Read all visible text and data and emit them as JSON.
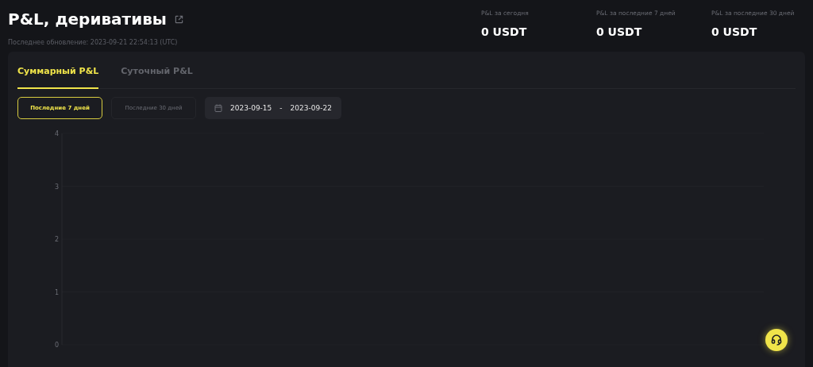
{
  "header": {
    "title": "P&L, деривативы",
    "updated": "Последнее обновление: 2023-09-21 22:54:13 (UTC)"
  },
  "stats": [
    {
      "label": "P&L за сегодня",
      "value": "0 USDT"
    },
    {
      "label": "P&L за последние 7 дней",
      "value": "0 USDT"
    },
    {
      "label": "P&L за последние 30 дней",
      "value": "0 USDT"
    }
  ],
  "tabs": [
    {
      "label": "Суммарный P&L",
      "selected": true
    },
    {
      "label": "Суточный P&L",
      "selected": false
    }
  ],
  "periods": [
    {
      "label": "Последние 7 дней",
      "selected": true
    },
    {
      "label": "Последние 30 дней",
      "selected": false
    }
  ],
  "date_range": {
    "from": "2023-09-15",
    "separator": "-",
    "to": "2023-09-22"
  },
  "chart_panel": {
    "y_axis_labels": [
      "4",
      "3",
      "2",
      "1",
      "0"
    ]
  }
}
